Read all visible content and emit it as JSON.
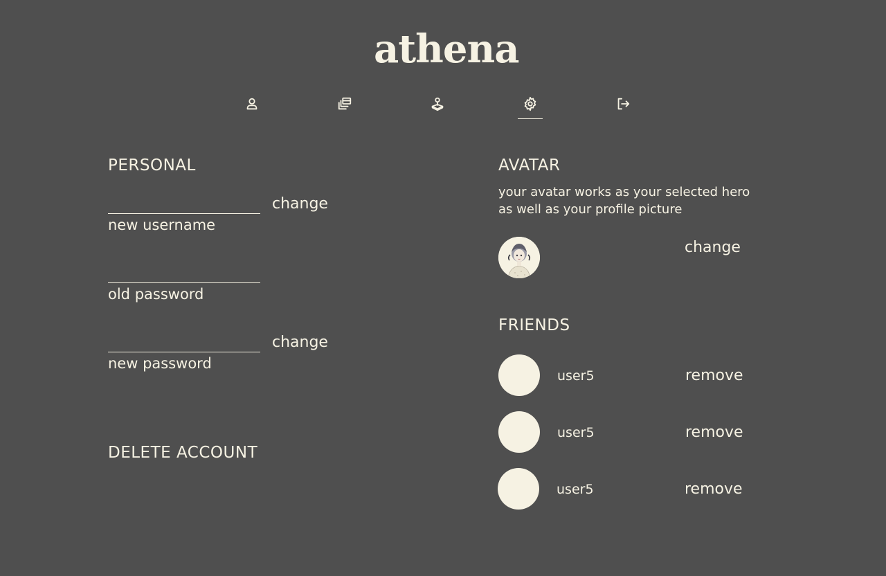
{
  "brand": {
    "logo": "athena"
  },
  "nav": {
    "items": [
      {
        "icon": "user-icon",
        "active": false
      },
      {
        "icon": "gallery-icon",
        "active": false
      },
      {
        "icon": "joystick-icon",
        "active": false
      },
      {
        "icon": "gear-icon",
        "active": true
      },
      {
        "icon": "logout-icon",
        "active": false
      }
    ]
  },
  "personal": {
    "title": "PERSONAL",
    "username": {
      "value": "",
      "caption": "new username",
      "action": "change"
    },
    "old_password": {
      "value": "",
      "caption": "old password"
    },
    "new_password": {
      "value": "",
      "caption": "new password",
      "action": "change"
    },
    "delete_label": "DELETE ACCOUNT"
  },
  "avatar": {
    "title": "AVATAR",
    "description": "your avatar works as your selected hero as well as your profile picture",
    "action": "change"
  },
  "friends": {
    "title": "FRIENDS",
    "list": [
      {
        "name": "user5",
        "action": "remove"
      },
      {
        "name": "user5",
        "action": "remove"
      },
      {
        "name": "user5",
        "action": "remove"
      }
    ]
  },
  "colors": {
    "background": "#4f4f4f",
    "foreground": "#f6f2e3"
  }
}
